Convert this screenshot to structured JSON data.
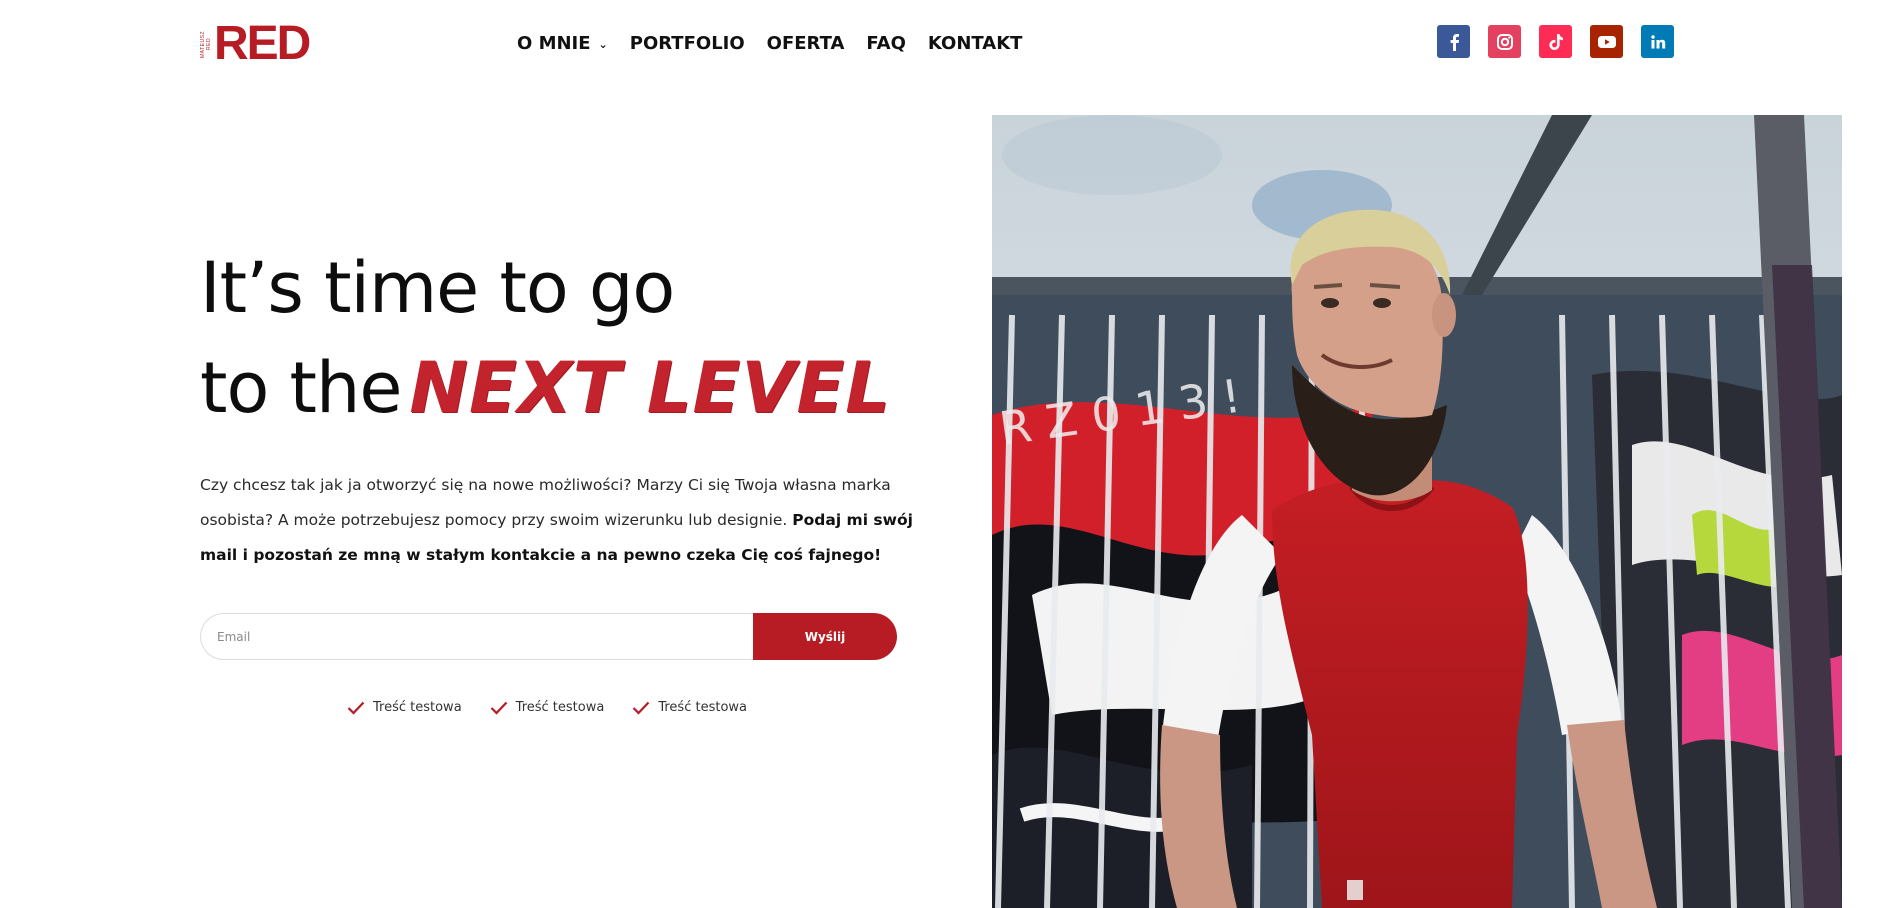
{
  "header": {
    "logo": {
      "text": "RED",
      "tag": "MATEUSZ RED"
    },
    "nav": [
      {
        "label": "O MNIE",
        "has_dropdown": true
      },
      {
        "label": "PORTFOLIO"
      },
      {
        "label": "OFERTA"
      },
      {
        "label": "FAQ"
      },
      {
        "label": "KONTAKT"
      }
    ],
    "social": [
      {
        "icon": "facebook-icon",
        "color": "#3b5998",
        "glyph": "f"
      },
      {
        "icon": "instagram-icon",
        "color": "#e4405f",
        "glyph": "◎"
      },
      {
        "icon": "tiktok-icon",
        "color": "#fe2c55",
        "glyph": "♪"
      },
      {
        "icon": "youtube-icon",
        "color": "#a82400",
        "glyph": "▶"
      },
      {
        "icon": "linkedin-icon",
        "color": "#007bb6",
        "glyph": "in"
      }
    ]
  },
  "hero": {
    "title_line1": "It’s time to go",
    "title_line2": "to the",
    "title_accent": "NEXT LEVEL",
    "desc_plain": "Czy chcesz tak jak ja otworzyć się na nowe możliwości? Marzy Ci się Twoja własna marka osobista? A może potrzebujesz pomocy przy swoim wizerunku lub designie. ",
    "desc_bold": "Podaj mi swój mail i pozostań ze mną w stałym kontakcie a na pewno czeka Cię coś fajnego!"
  },
  "form": {
    "email_placeholder": "Email",
    "submit_label": "Wyślij"
  },
  "features": [
    {
      "label": "Treść testowa"
    },
    {
      "label": "Treść testowa"
    },
    {
      "label": "Treść testowa"
    }
  ],
  "colors": {
    "accent": "#b71c24",
    "text": "#111111"
  }
}
